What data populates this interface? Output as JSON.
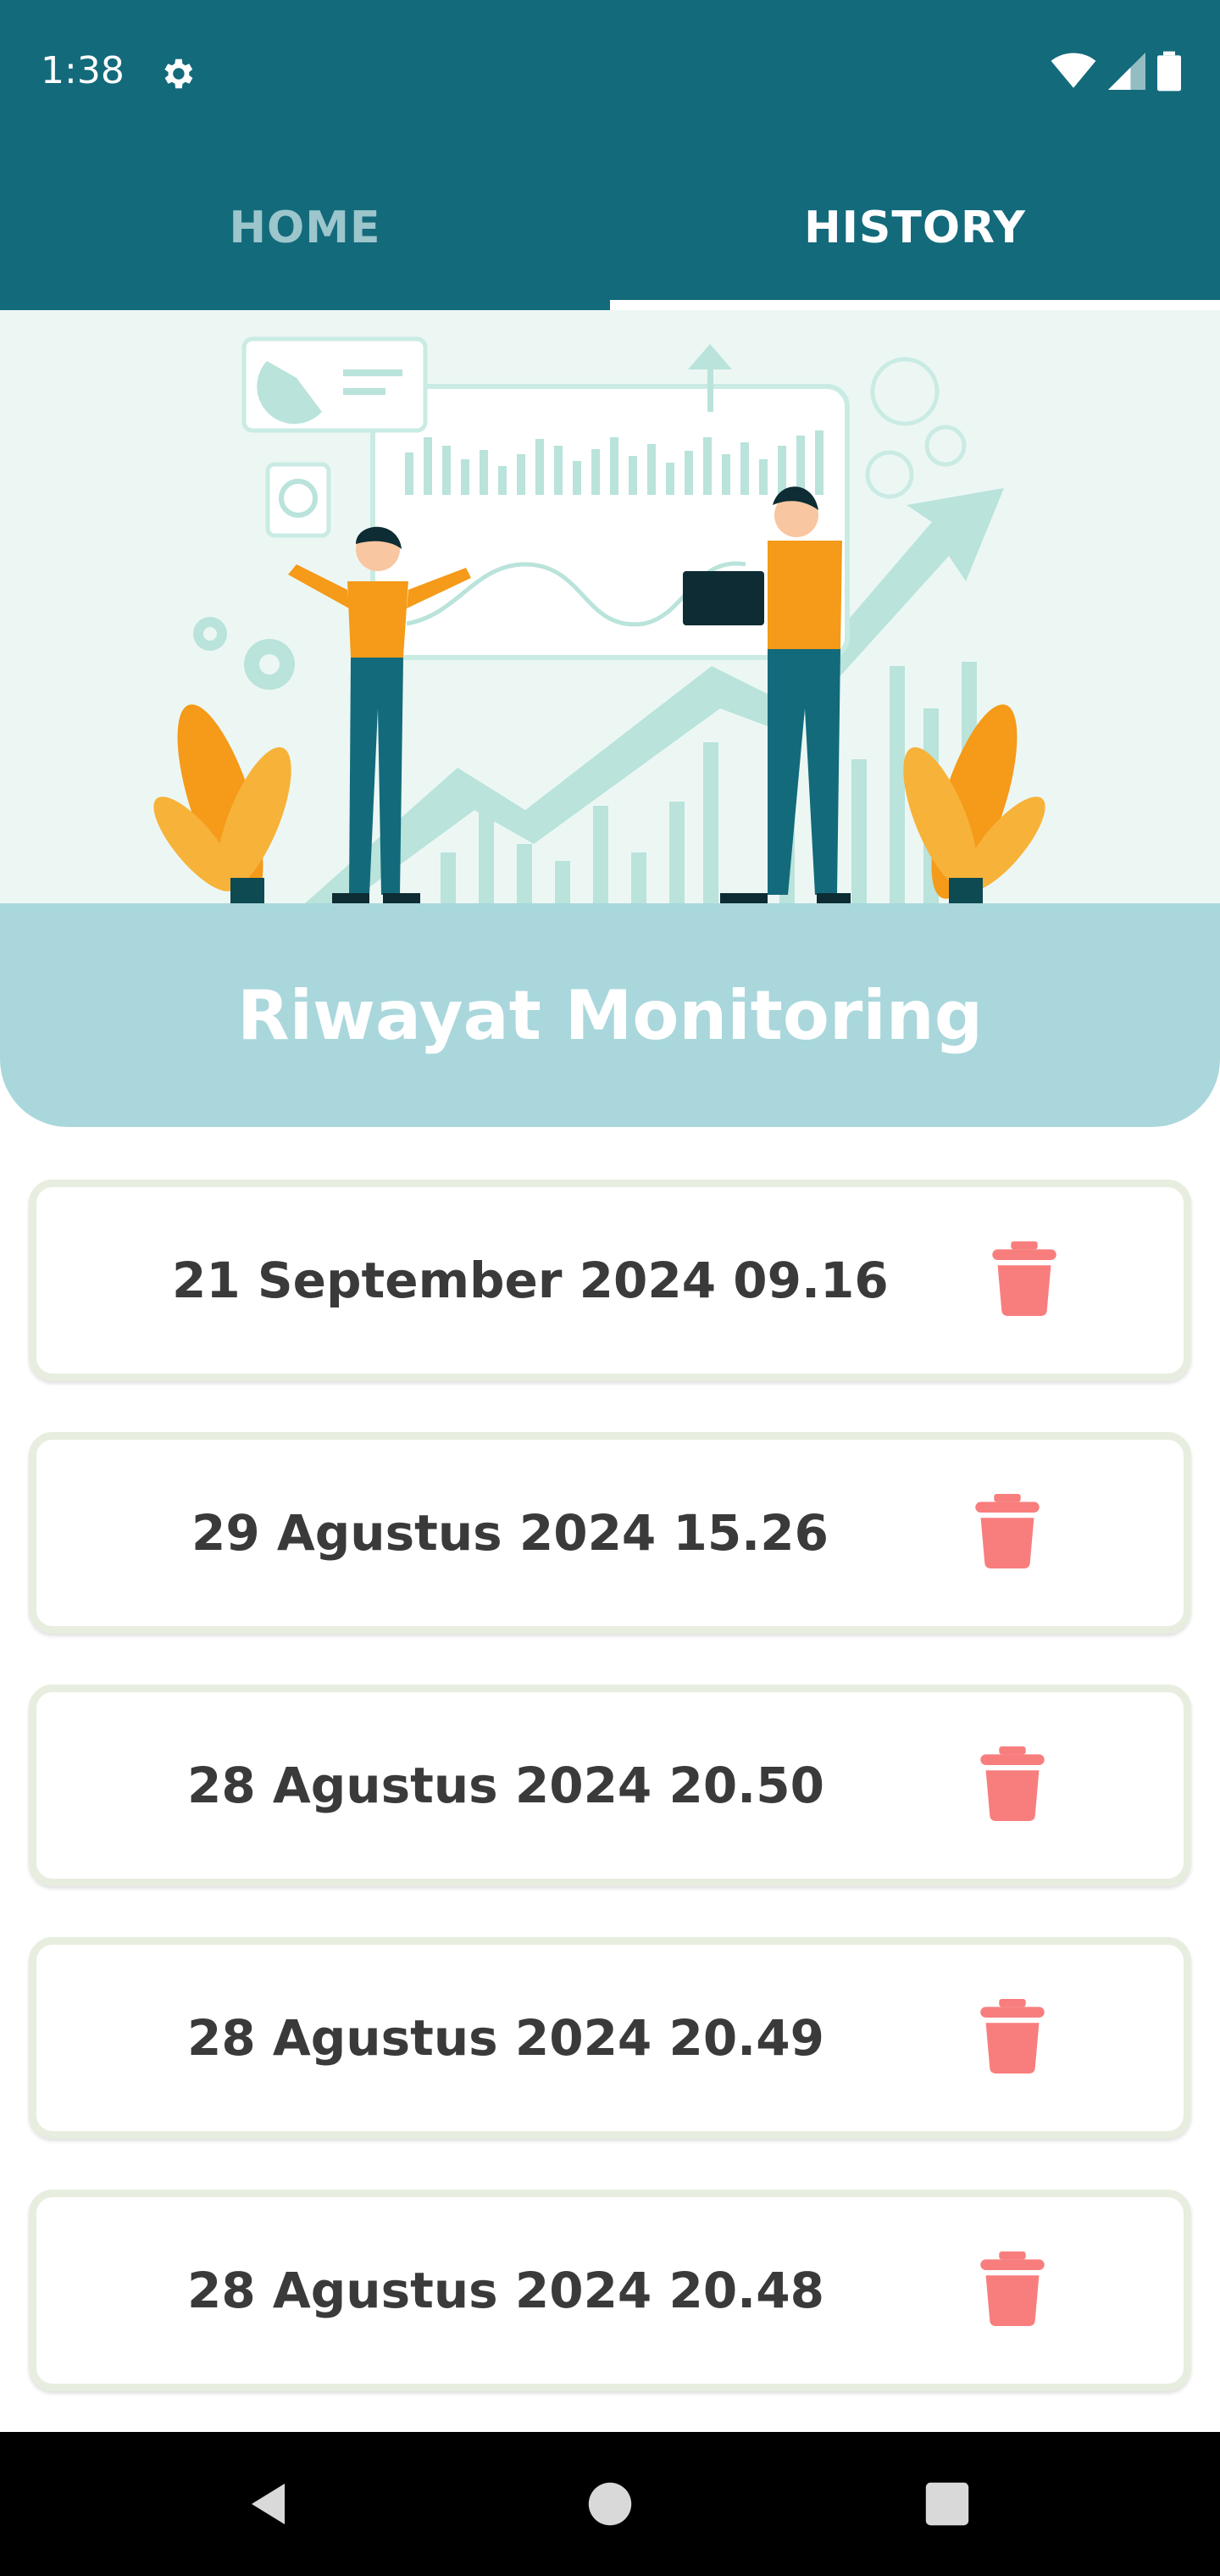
{
  "status": {
    "time": "1:38"
  },
  "tabs": [
    {
      "label": "HOME",
      "active": false
    },
    {
      "label": "HISTORY",
      "active": true
    }
  ],
  "header": {
    "title": "Riwayat Monitoring"
  },
  "history": [
    {
      "label": "21 September 2024 09.16"
    },
    {
      "label": "29 Agustus 2024 15.26"
    },
    {
      "label": "28 Agustus 2024 20.50"
    },
    {
      "label": "28 Agustus 2024 20.49"
    },
    {
      "label": "28 Agustus 2024 20.48"
    }
  ],
  "colors": {
    "primary": "#136a7b",
    "title_panel": "#a9d7dc",
    "card_border": "#e7eedf",
    "trash": "#f87e7e",
    "text": "#3a3a3a"
  }
}
